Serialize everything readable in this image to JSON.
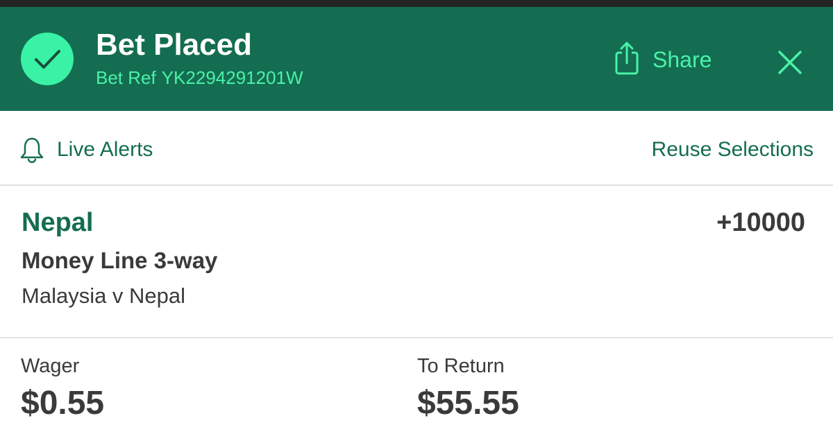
{
  "header": {
    "title": "Bet Placed",
    "bet_ref_prefix": "Bet Ref",
    "bet_ref": "YK2294291201W",
    "share_label": "Share",
    "icons": {
      "status": "checkmark-icon",
      "share": "share-icon",
      "close": "close-icon"
    }
  },
  "actions": {
    "live_alerts_label": "Live Alerts",
    "reuse_label": "Reuse Selections",
    "icons": {
      "alerts": "bell-icon"
    }
  },
  "selection": {
    "name": "Nepal",
    "odds": "+10000",
    "market": "Money Line 3-way",
    "event": "Malaysia v Nepal"
  },
  "totals": {
    "wager_label": "Wager",
    "wager_value": "$0.55",
    "return_label": "To Return",
    "return_value": "$55.55"
  },
  "colors": {
    "brand_green": "#146d51",
    "accent_mint": "#39f2a6",
    "text_dark": "#3a3a3a"
  }
}
